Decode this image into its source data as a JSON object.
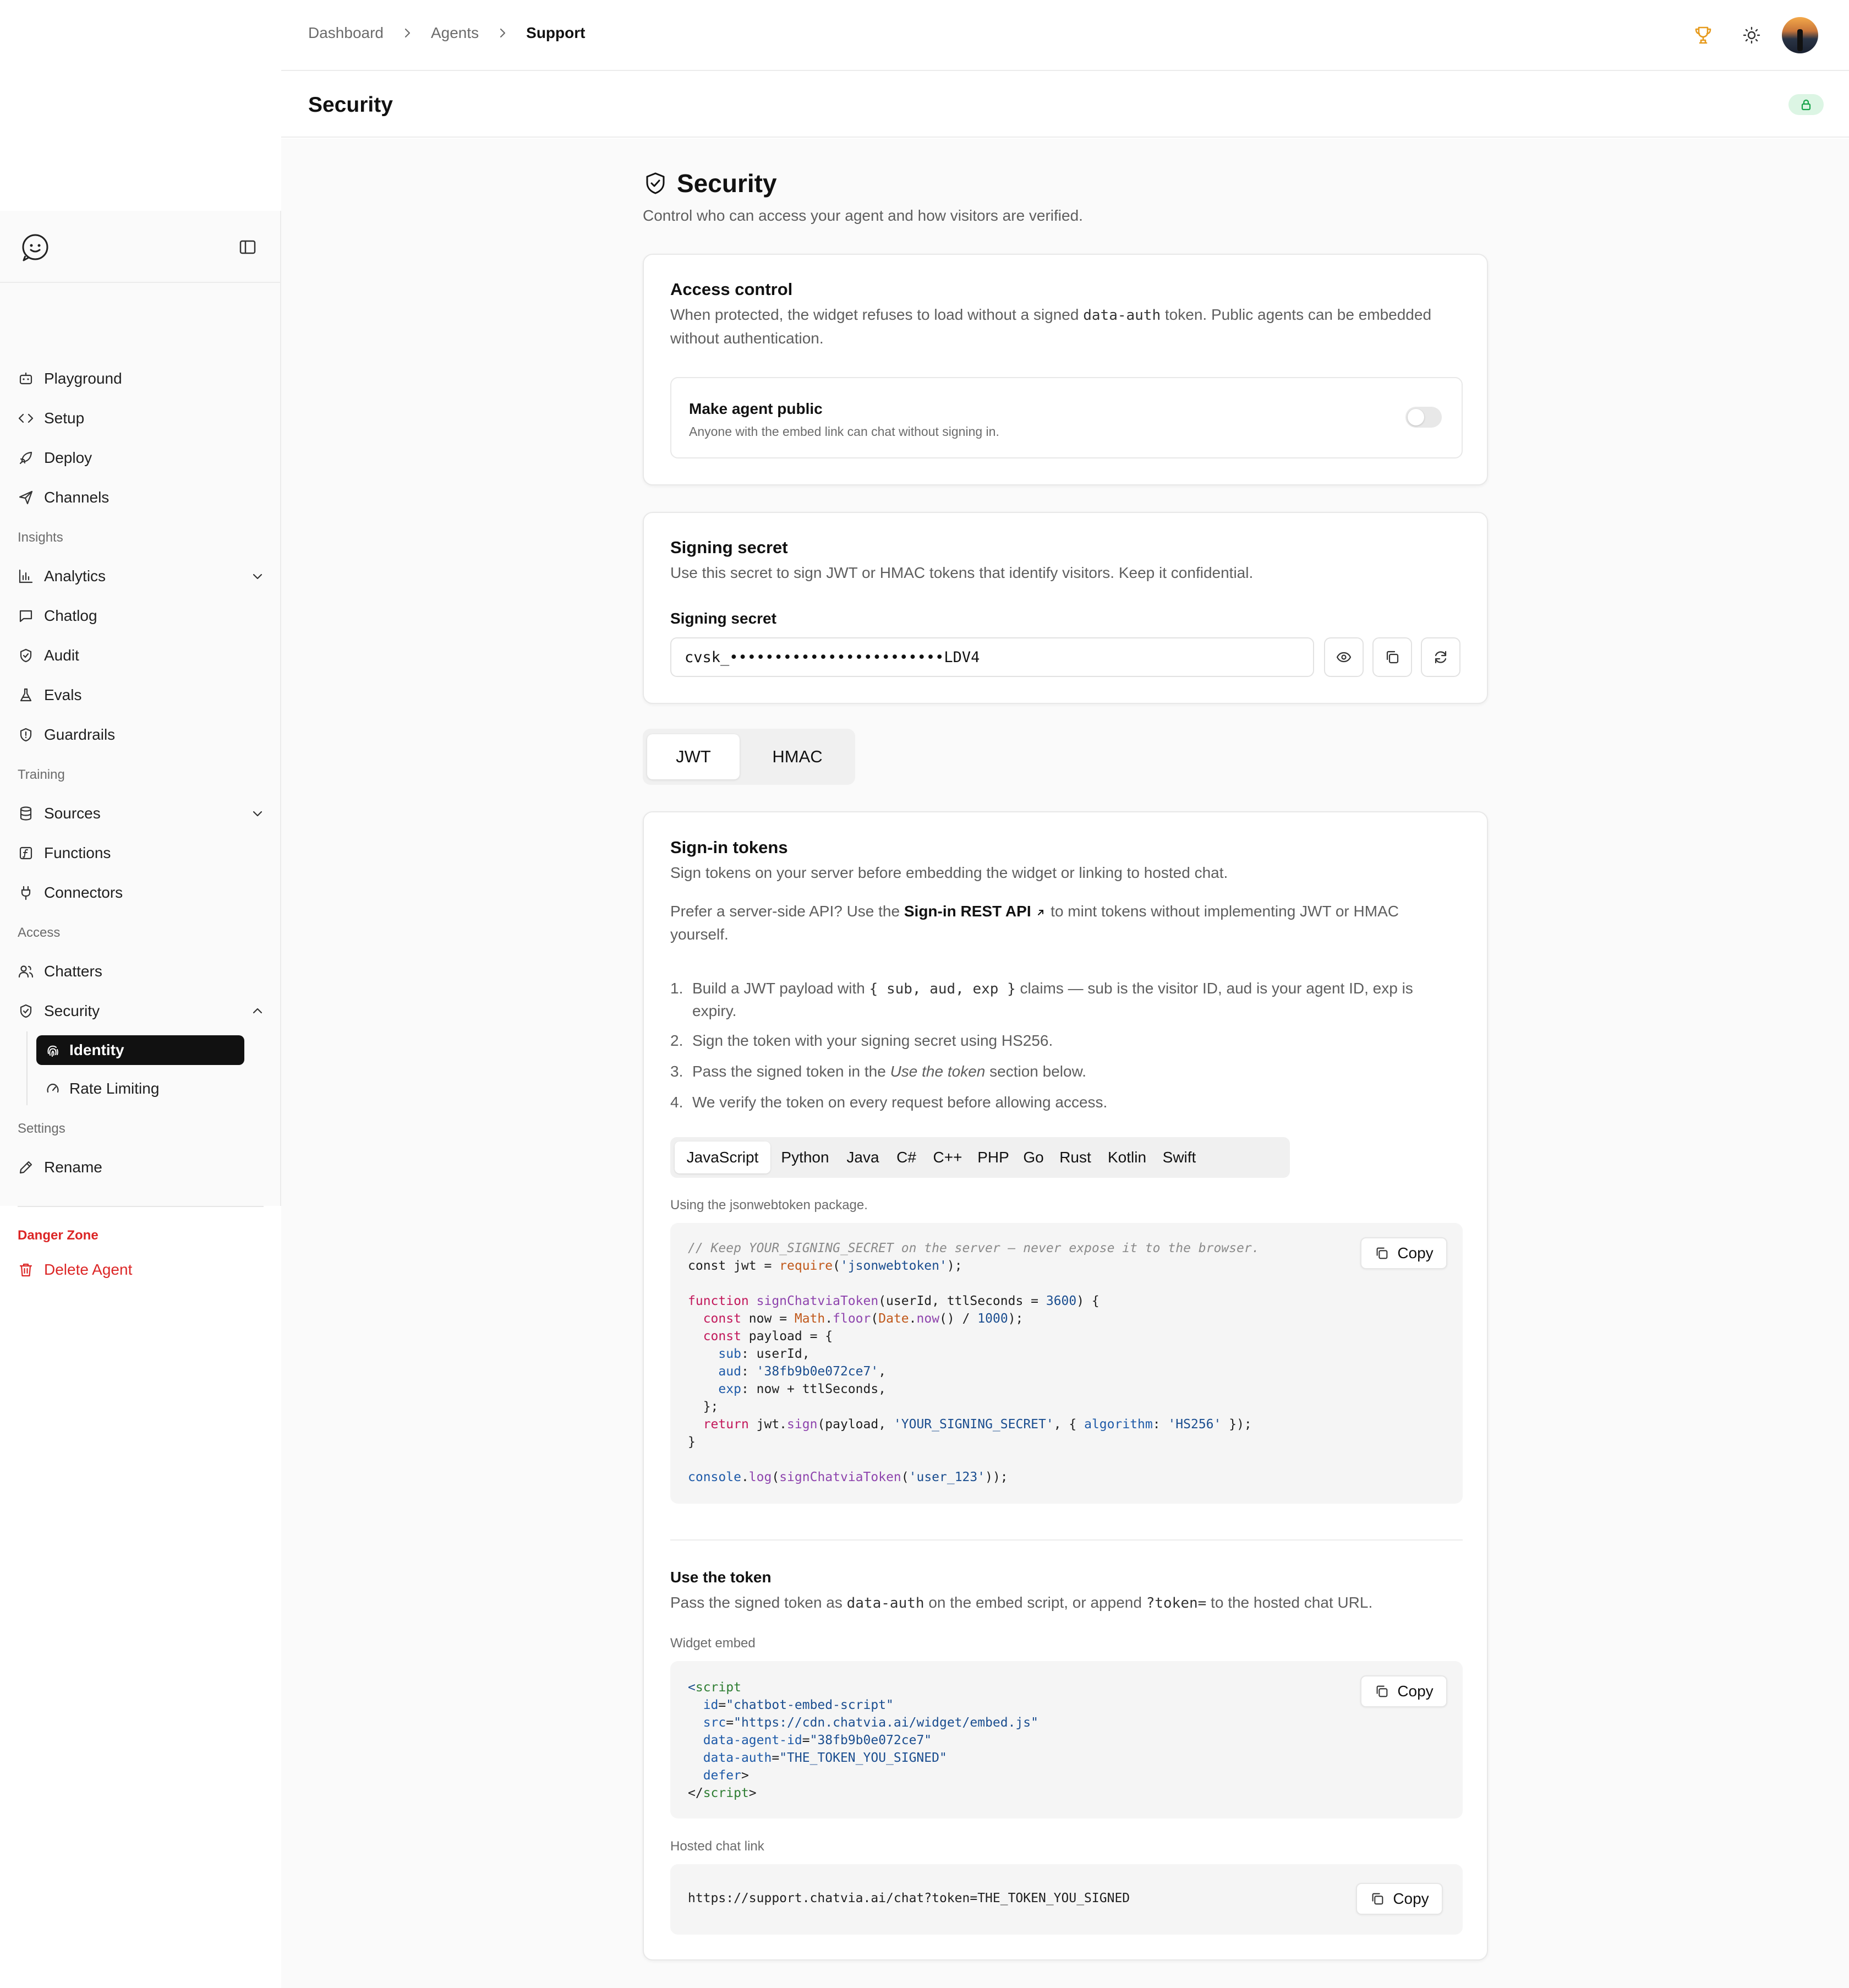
{
  "breadcrumb": [
    "Dashboard",
    "Agents",
    "Support"
  ],
  "page_title": "Security",
  "sidebar": {
    "items_top": [
      "Playground",
      "Setup",
      "Deploy",
      "Channels"
    ],
    "section_insights": "Insights",
    "items_insights": [
      "Analytics",
      "Chatlog",
      "Audit",
      "Evals",
      "Guardrails"
    ],
    "section_training": "Training",
    "items_training": [
      "Sources",
      "Functions",
      "Connectors"
    ],
    "section_access": "Access",
    "items_access": [
      "Chatters",
      "Security"
    ],
    "security_sub": [
      "Identity",
      "Rate Limiting"
    ],
    "section_settings": "Settings",
    "items_settings": [
      "Rename"
    ],
    "danger_label": "Danger Zone",
    "danger_item": "Delete Agent"
  },
  "main": {
    "heading": "Security",
    "description": "Control who can access your agent and how visitors are verified."
  },
  "access_control": {
    "title": "Access control",
    "text_before": "When protected, the widget refuses to load without a signed ",
    "text_code": "data-auth",
    "text_after": " token. Public agents can be embedded without authentication.",
    "toggle_label": "Make agent public",
    "toggle_hint": "Anyone with the embed link can chat without signing in.",
    "toggle_on": false
  },
  "signing_secret": {
    "title": "Signing secret",
    "text": "Use this secret to sign JWT or HMAC tokens that identify visitors. Keep it confidential.",
    "field_label": "Signing secret",
    "value": "cvsk_••••••••••••••••••••••••LDV4"
  },
  "method_tabs": [
    "JWT",
    "HMAC"
  ],
  "active_method": "JWT",
  "sign_in": {
    "title": "Sign-in tokens",
    "text": "Sign tokens on your server before embedding the widget or linking to hosted chat.",
    "api_before": "Prefer a server-side API? Use the ",
    "api_link": "Sign-in REST API",
    "api_after": " to mint tokens without implementing JWT or HMAC yourself.",
    "steps": [
      {
        "num": "1.",
        "before": "Build a JWT payload with ",
        "code": "{ sub, aud, exp }",
        "after": " claims — sub is the visitor ID, aud is your agent ID, exp is expiry."
      },
      {
        "num": "2.",
        "before": "Sign the token with your signing secret using HS256.",
        "code": "",
        "after": ""
      },
      {
        "num": "3.",
        "before": "Pass the signed token in the ",
        "code": "",
        "italic": "Use the token",
        "after": " section below."
      },
      {
        "num": "4.",
        "before": "We verify the token on every request before allowing access.",
        "code": "",
        "after": ""
      }
    ],
    "languages": [
      "JavaScript",
      "Python",
      "Java",
      "C#",
      "C++",
      "PHP",
      "Go",
      "Rust",
      "Kotlin",
      "Swift"
    ],
    "active_language": "JavaScript",
    "package_note": "Using the jsonwebtoken package.",
    "copy_label": "Copy"
  },
  "use_token": {
    "title": "Use the token",
    "text_before": "Pass the signed token as ",
    "code1": "data-auth",
    "text_mid": " on the embed script, or append ",
    "code2": "?token=",
    "text_after": " to the hosted chat URL.",
    "widget_label": "Widget embed",
    "hosted_label": "Hosted chat link",
    "hosted_url": "https://support.chatvia.ai/chat?token=THE_TOKEN_YOU_SIGNED",
    "copy_label": "Copy"
  }
}
